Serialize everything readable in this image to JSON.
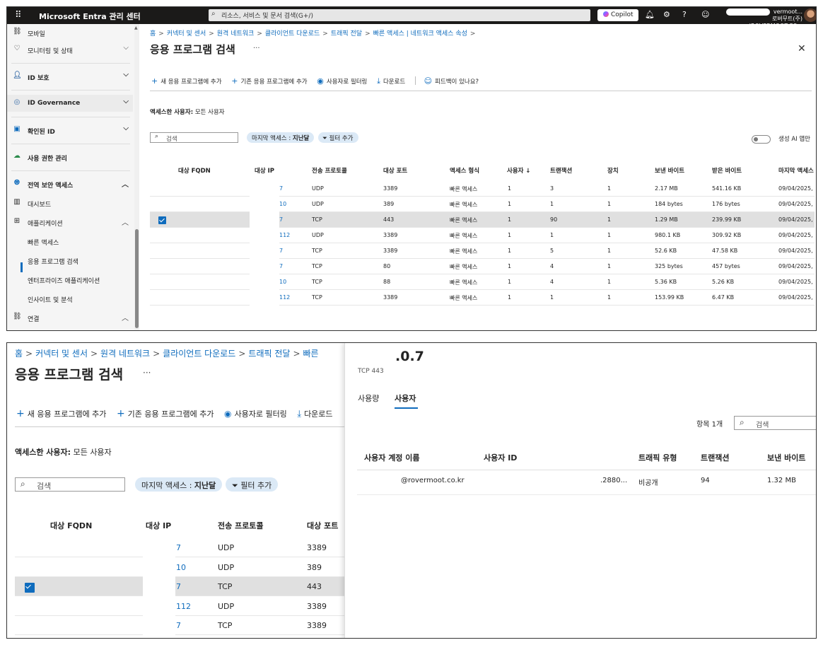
{
  "top": {
    "app_title": "Microsoft Entra 관리 센터",
    "search_placeholder": "리소스, 서비스 및 문서 검색(G+/)",
    "copilot_label": "Copilot",
    "account_name": "vermoot...",
    "account_org": "로버무트(주)(ROVERMOOT.CO...",
    "sidebar": [
      {
        "label": "모바일",
        "icon": "link-icon"
      },
      {
        "label": "모니터링 및 상태",
        "icon": "heart-pulse-icon"
      },
      {
        "label": "ID 보호",
        "icon": "id-protection-icon"
      },
      {
        "label": "ID Governance",
        "icon": "governance-icon"
      },
      {
        "label": "확인된 ID",
        "icon": "verified-id-icon"
      },
      {
        "label": "사용 권한 관리",
        "icon": "cloud-icon"
      },
      {
        "label": "전역 보안 액세스",
        "icon": "globe-icon"
      },
      {
        "label": "대시보드",
        "icon": "dashboard-icon"
      },
      {
        "label": "애플리케이션",
        "icon": "apps-icon"
      },
      {
        "label": "빠른 액세스",
        "icon": ""
      },
      {
        "label": "응용 프로그램 검색",
        "icon": ""
      },
      {
        "label": "엔터프라이즈 애플리케이션",
        "icon": ""
      },
      {
        "label": "인사이트 및 분석",
        "icon": ""
      },
      {
        "label": "연결",
        "icon": "link-icon"
      }
    ],
    "breadcrumb": [
      "홈",
      "커넥터 및 센서",
      "원격 네트워크",
      "클라이언트 다운로드",
      "트래픽 전달",
      "빠른 액세스 | 네트워크 액세스 속성"
    ],
    "page_title": "응용 프로그램 검색",
    "commands": [
      "새 응용 프로그램에 추가",
      "기존 응용 프로그램에 추가",
      "사용자로 필터링",
      "다운로드",
      "피드백이 있나요?"
    ],
    "accessed_by_label": "액세스한 사용자:",
    "accessed_by_value": "모든 사용자",
    "search_placeholder_grid": "검색",
    "last_access_label": "마지막 액세스 :",
    "last_access_value": "지난달",
    "add_filter": "필터 추가",
    "gen_ai_label": "생성 AI 앱만",
    "columns": [
      "대상 FQDN",
      "대상 IP",
      "전송 프로토콜",
      "대상 포트",
      "액세스 형식",
      "사용자 ↓",
      "트랜잭션",
      "장치",
      "보낸 바이트",
      "받은 바이트",
      "마지막 액세스"
    ],
    "rows": [
      {
        "ip": "7",
        "proto": "UDP",
        "port": "3389",
        "type": "빠른 액세스",
        "users": "1",
        "tx": "3",
        "dev": "1",
        "sent": "2.17 MB",
        "recv": "541.16 KB",
        "last": "09/04/2025,"
      },
      {
        "ip": "10",
        "proto": "UDP",
        "port": "389",
        "type": "빠른 액세스",
        "users": "1",
        "tx": "1",
        "dev": "1",
        "sent": "184 bytes",
        "recv": "176 bytes",
        "last": "09/04/2025,"
      },
      {
        "ip": "7",
        "proto": "TCP",
        "port": "443",
        "type": "빠른 액세스",
        "users": "1",
        "tx": "90",
        "dev": "1",
        "sent": "1.29 MB",
        "recv": "239.99 KB",
        "last": "09/04/2025,"
      },
      {
        "ip": "112",
        "proto": "UDP",
        "port": "3389",
        "type": "빠른 액세스",
        "users": "1",
        "tx": "1",
        "dev": "1",
        "sent": "980.1 KB",
        "recv": "309.92 KB",
        "last": "09/04/2025,"
      },
      {
        "ip": "7",
        "proto": "TCP",
        "port": "3389",
        "type": "빠른 액세스",
        "users": "1",
        "tx": "5",
        "dev": "1",
        "sent": "52.6 KB",
        "recv": "47.58 KB",
        "last": "09/04/2025,"
      },
      {
        "ip": "7",
        "proto": "TCP",
        "port": "80",
        "type": "빠른 액세스",
        "users": "1",
        "tx": "4",
        "dev": "1",
        "sent": "325 bytes",
        "recv": "457 bytes",
        "last": "09/04/2025,"
      },
      {
        "ip": "10",
        "proto": "TCP",
        "port": "88",
        "type": "빠른 액세스",
        "users": "1",
        "tx": "4",
        "dev": "1",
        "sent": "5.36 KB",
        "recv": "5.26 KB",
        "last": "09/04/2025,"
      },
      {
        "ip": "112",
        "proto": "TCP",
        "port": "3389",
        "type": "빠른 액세스",
        "users": "1",
        "tx": "1",
        "dev": "1",
        "sent": "153.99 KB",
        "recv": "6.47 KB",
        "last": "09/04/2025,"
      }
    ]
  },
  "bottom": {
    "breadcrumb": [
      "홈",
      "커넥터 및 센서",
      "원격 네트워크",
      "클라이언트 다운로드",
      "트래픽 전달",
      "빠른"
    ],
    "page_title": "응용 프로그램 검색",
    "commands": [
      "새 응용 프로그램에 추가",
      "기존 응용 프로그램에 추가",
      "사용자로 필터링",
      "다운로드"
    ],
    "accessed_by_label": "액세스한 사용자:",
    "accessed_by_value": "모든 사용자",
    "search_placeholder": "검색",
    "last_access_label": "마지막 액세스 :",
    "last_access_value": "지난달",
    "add_filter": "필터 추가",
    "columns": [
      "대상 FQDN",
      "대상 IP",
      "전송 프로토콜",
      "대상 포트"
    ],
    "rows": [
      {
        "ip": "7",
        "proto": "UDP",
        "port": "3389"
      },
      {
        "ip": "10",
        "proto": "UDP",
        "port": "389"
      },
      {
        "ip": "7",
        "proto": "TCP",
        "port": "443"
      },
      {
        "ip": "112",
        "proto": "UDP",
        "port": "3389"
      },
      {
        "ip": "7",
        "proto": "TCP",
        "port": "3389"
      }
    ],
    "detail": {
      "title": ".0.7",
      "subtitle": "TCP 443",
      "tabs": [
        "사용량",
        "사용자"
      ],
      "item_count": "항목 1개",
      "search_placeholder": "검색",
      "columns": [
        "사용자 계정 이름",
        "사용자 ID",
        "트래픽 유형",
        "트랜잭션",
        "보낸 바이트"
      ],
      "row": {
        "upn": "@rovermoot.co.kr",
        "uid": ".2880...",
        "traffic": "비공개",
        "tx": "94",
        "sent": "1.32 MB"
      }
    }
  }
}
